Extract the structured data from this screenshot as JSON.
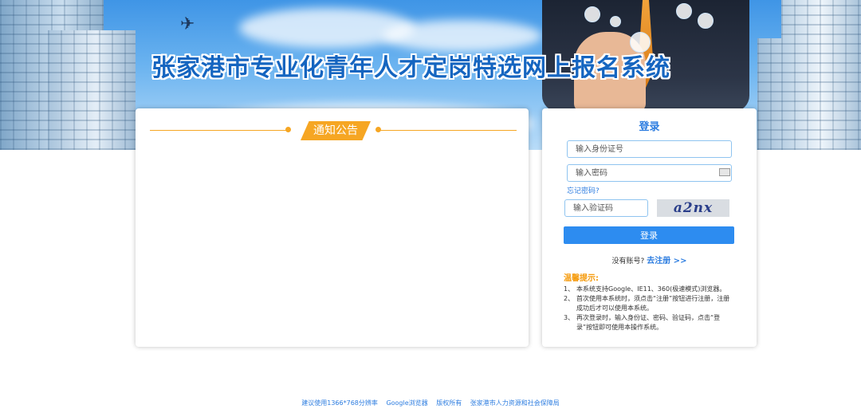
{
  "header": {
    "title": "张家港市专业化青年人才定岗特选网上报名系统"
  },
  "notice": {
    "tab_label": "通知公告"
  },
  "login": {
    "title": "登录",
    "id_placeholder": "输入身份证号",
    "password_placeholder": "输入密码",
    "forgot_label": "忘记密码?",
    "captcha_placeholder": "输入验证码",
    "captcha_text": "a2nx",
    "submit_label": "登录",
    "no_account_text": "没有账号?",
    "register_link": "去注册  >>",
    "tips_title": "温馨提示:",
    "tips": [
      {
        "num": "1、",
        "text": "本系统支持Google、IE11、360(极速模式)浏览器。"
      },
      {
        "num": "2、",
        "text": "首次使用本系统时，须点击“注册”按钮进行注册，注册成功后才可以使用本系统。"
      },
      {
        "num": "3、",
        "text": "再次登录时，输入身份证、密码、验证码，点击“登录”按钮即可使用本操作系统。"
      }
    ]
  },
  "footer": {
    "resolution": "建议使用1366*768分辨率",
    "browser": "Google浏览器",
    "copyright": "版权所有",
    "owner": "张家港市人力资源和社会保障局"
  },
  "colors": {
    "accent": "#2d8cf0",
    "notice_orange": "#f6a623",
    "title_blue": "#1565c0"
  }
}
